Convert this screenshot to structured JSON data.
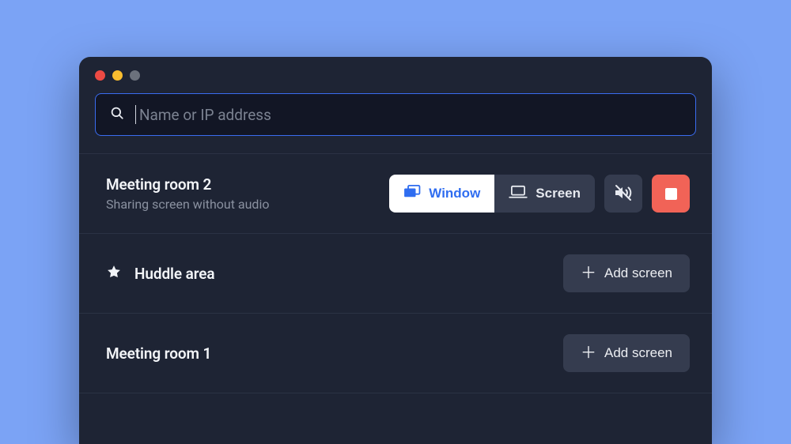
{
  "search": {
    "placeholder": "Name or IP address",
    "value": ""
  },
  "rooms": [
    {
      "name": "Meeting room 2",
      "subtitle": "Sharing screen without audio",
      "segment": {
        "window": "Window",
        "screen": "Screen"
      }
    },
    {
      "name": "Huddle area",
      "add_label": "Add screen"
    },
    {
      "name": "Meeting room 1",
      "add_label": "Add screen"
    }
  ],
  "colors": {
    "accent": "#2f6df0",
    "danger": "#f16357",
    "panel": "#353c4f",
    "bg": "#1e2434"
  }
}
